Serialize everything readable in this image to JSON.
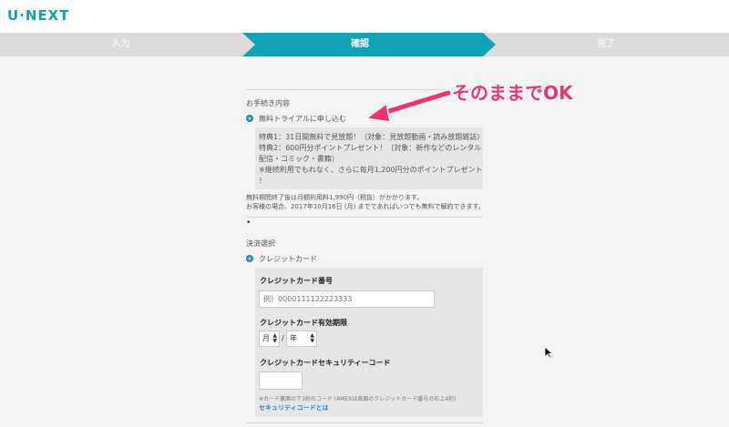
{
  "brand": {
    "logo": "U·NEXT",
    "accent": "#0aa3b5"
  },
  "steps": [
    {
      "label": "入力",
      "state": "done"
    },
    {
      "label": "確認",
      "state": "active"
    },
    {
      "label": "完了",
      "state": "pending"
    }
  ],
  "procedure": {
    "heading": "お手続き内容",
    "option_label": "無料トライアルに申し込む",
    "perks": [
      "特典1：31日間無料で見放題！（対象：見放題動画・読み放題雑誌）",
      "特典2：600円分ポイントプレゼント！（対象：新作などのレンタル",
      "配信・コミック・書籍）",
      "※継続利用でもれなく、さらに毎月1,200円分のポイントプレゼント",
      "！"
    ],
    "notes": [
      "無料期間終了後は月額利用料1,990円（税抜）がかかります。",
      "お客様の場合、2017年10月16日 (月) までであればいつでも無料で解約できます。"
    ],
    "bullet": "•"
  },
  "payment": {
    "heading": "決済選択",
    "option_label": "クレジットカード",
    "card_number_label": "クレジットカード番号",
    "card_number_placeholder": "例）0000111122223333",
    "expiry_label": "クレジットカード有効期限",
    "expiry_month": "月",
    "expiry_separator": "/",
    "expiry_year": "年",
    "cvc_label": "クレジットカードセキュリティーコード",
    "cvc_value": "",
    "cvc_help": "※カード裏面の下3桁のコード (AMEXは表面のクレジットカード番号の右上4桁)",
    "cvc_link": "セキュリティコードとは"
  },
  "annotation": {
    "text": "そのままでOK",
    "color": "#f2316e"
  }
}
